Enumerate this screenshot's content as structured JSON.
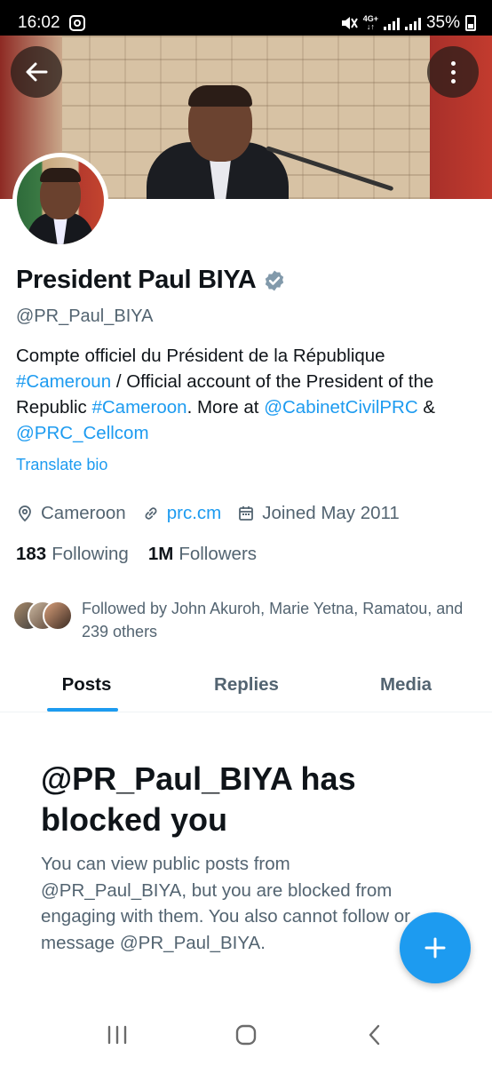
{
  "status_bar": {
    "time": "16:02",
    "network": "4G+",
    "battery": "35%"
  },
  "profile": {
    "name": "President Paul BIYA",
    "handle": "@PR_Paul_BIYA",
    "bio": {
      "part1": "Compte officiel du Président de la République ",
      "tag1": "#Cameroun",
      "part2": " / Official account of the President of the Republic  ",
      "tag2": "#Cameroon",
      "part3": ". More at ",
      "mention1": "@CabinetCivilPRC",
      "part4": " & ",
      "mention2": "@PRC_Cellcom"
    },
    "translate_label": "Translate bio",
    "location": "Cameroon",
    "website": "prc.cm",
    "joined": "Joined May 2011",
    "following_count": "183",
    "following_label": "Following",
    "followers_count": "1M",
    "followers_label": "Followers",
    "followed_by": "Followed by John Akuroh, Marie Yetna, Ramatou, and 239 others"
  },
  "tabs": [
    {
      "label": "Posts",
      "active": true
    },
    {
      "label": "Replies",
      "active": false
    },
    {
      "label": "Media",
      "active": false
    }
  ],
  "blocked": {
    "title": "@PR_Paul_BIYA has blocked you",
    "body": "You can view public posts from @PR_Paul_BIYA, but you are blocked from engaging with them. You also cannot follow or message @PR_Paul_BIYA."
  },
  "colors": {
    "accent": "#1d9bf0",
    "text_primary": "#0f1419",
    "text_secondary": "#536471",
    "verified": "#829aab"
  },
  "icons": {
    "back": "arrow-left-icon",
    "more": "more-vertical-icon",
    "location": "location-pin-icon",
    "link": "link-icon",
    "calendar": "calendar-icon",
    "verified": "verified-badge-icon",
    "compose": "plus-icon"
  }
}
